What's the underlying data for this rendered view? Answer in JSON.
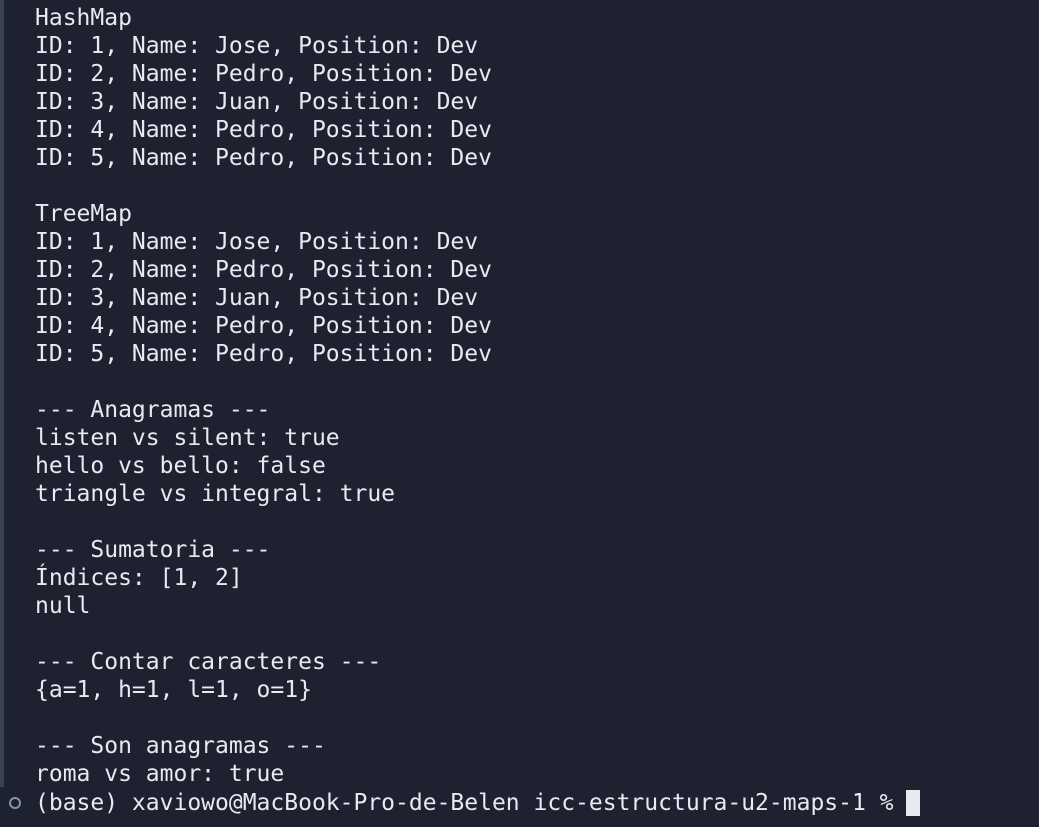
{
  "terminal": {
    "output_lines": [
      "HashMap",
      "ID: 1, Name: Jose, Position: Dev",
      "ID: 2, Name: Pedro, Position: Dev",
      "ID: 3, Name: Juan, Position: Dev",
      "ID: 4, Name: Pedro, Position: Dev",
      "ID: 5, Name: Pedro, Position: Dev",
      "",
      "TreeMap",
      "ID: 1, Name: Jose, Position: Dev",
      "ID: 2, Name: Pedro, Position: Dev",
      "ID: 3, Name: Juan, Position: Dev",
      "ID: 4, Name: Pedro, Position: Dev",
      "ID: 5, Name: Pedro, Position: Dev",
      "",
      "--- Anagramas ---",
      "listen vs silent: true",
      "hello vs bello: false",
      "triangle vs integral: true",
      "",
      "--- Sumatoria ---",
      "Índices: [1, 2]",
      "null",
      "",
      "--- Contar caracteres ---",
      "{a=1, h=1, l=1, o=1}",
      "",
      "--- Son anagramas ---",
      "roma vs amor: true"
    ],
    "prompt": "(base) xaviowo@MacBook-Pro-de-Belen icc-estructura-u2-maps-1 %",
    "colors": {
      "background": "#1e2230",
      "foreground": "#e8eaf0",
      "gutter": "#3a4155"
    },
    "icons": {
      "prompt_marker": "circle-outline-icon",
      "cursor": "block-cursor"
    }
  }
}
